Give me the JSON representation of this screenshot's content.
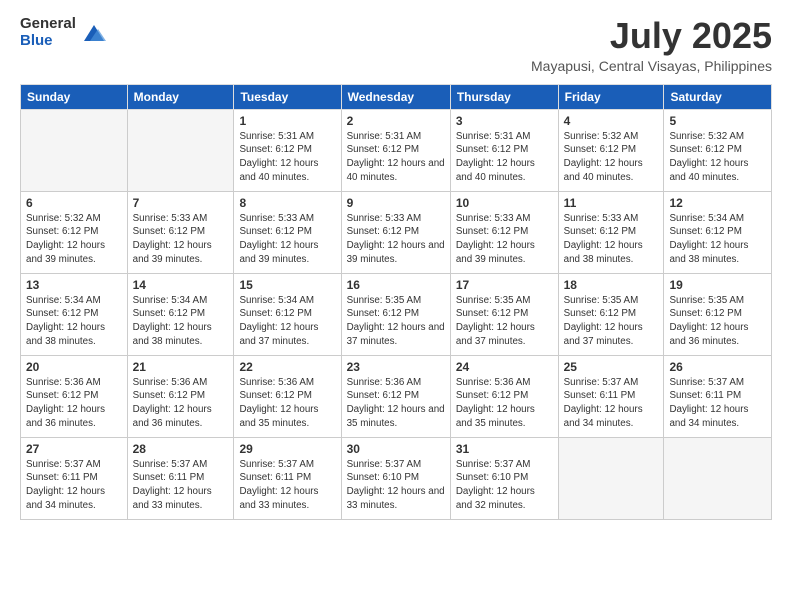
{
  "logo": {
    "general": "General",
    "blue": "Blue"
  },
  "header": {
    "title": "July 2025",
    "subtitle": "Mayapusi, Central Visayas, Philippines"
  },
  "weekdays": [
    "Sunday",
    "Monday",
    "Tuesday",
    "Wednesday",
    "Thursday",
    "Friday",
    "Saturday"
  ],
  "weeks": [
    [
      {
        "day": "",
        "empty": true
      },
      {
        "day": "",
        "empty": true
      },
      {
        "day": "1",
        "sunrise": "Sunrise: 5:31 AM",
        "sunset": "Sunset: 6:12 PM",
        "daylight": "Daylight: 12 hours and 40 minutes."
      },
      {
        "day": "2",
        "sunrise": "Sunrise: 5:31 AM",
        "sunset": "Sunset: 6:12 PM",
        "daylight": "Daylight: 12 hours and 40 minutes."
      },
      {
        "day": "3",
        "sunrise": "Sunrise: 5:31 AM",
        "sunset": "Sunset: 6:12 PM",
        "daylight": "Daylight: 12 hours and 40 minutes."
      },
      {
        "day": "4",
        "sunrise": "Sunrise: 5:32 AM",
        "sunset": "Sunset: 6:12 PM",
        "daylight": "Daylight: 12 hours and 40 minutes."
      },
      {
        "day": "5",
        "sunrise": "Sunrise: 5:32 AM",
        "sunset": "Sunset: 6:12 PM",
        "daylight": "Daylight: 12 hours and 40 minutes."
      }
    ],
    [
      {
        "day": "6",
        "sunrise": "Sunrise: 5:32 AM",
        "sunset": "Sunset: 6:12 PM",
        "daylight": "Daylight: 12 hours and 39 minutes."
      },
      {
        "day": "7",
        "sunrise": "Sunrise: 5:33 AM",
        "sunset": "Sunset: 6:12 PM",
        "daylight": "Daylight: 12 hours and 39 minutes."
      },
      {
        "day": "8",
        "sunrise": "Sunrise: 5:33 AM",
        "sunset": "Sunset: 6:12 PM",
        "daylight": "Daylight: 12 hours and 39 minutes."
      },
      {
        "day": "9",
        "sunrise": "Sunrise: 5:33 AM",
        "sunset": "Sunset: 6:12 PM",
        "daylight": "Daylight: 12 hours and 39 minutes."
      },
      {
        "day": "10",
        "sunrise": "Sunrise: 5:33 AM",
        "sunset": "Sunset: 6:12 PM",
        "daylight": "Daylight: 12 hours and 39 minutes."
      },
      {
        "day": "11",
        "sunrise": "Sunrise: 5:33 AM",
        "sunset": "Sunset: 6:12 PM",
        "daylight": "Daylight: 12 hours and 38 minutes."
      },
      {
        "day": "12",
        "sunrise": "Sunrise: 5:34 AM",
        "sunset": "Sunset: 6:12 PM",
        "daylight": "Daylight: 12 hours and 38 minutes."
      }
    ],
    [
      {
        "day": "13",
        "sunrise": "Sunrise: 5:34 AM",
        "sunset": "Sunset: 6:12 PM",
        "daylight": "Daylight: 12 hours and 38 minutes."
      },
      {
        "day": "14",
        "sunrise": "Sunrise: 5:34 AM",
        "sunset": "Sunset: 6:12 PM",
        "daylight": "Daylight: 12 hours and 38 minutes."
      },
      {
        "day": "15",
        "sunrise": "Sunrise: 5:34 AM",
        "sunset": "Sunset: 6:12 PM",
        "daylight": "Daylight: 12 hours and 37 minutes."
      },
      {
        "day": "16",
        "sunrise": "Sunrise: 5:35 AM",
        "sunset": "Sunset: 6:12 PM",
        "daylight": "Daylight: 12 hours and 37 minutes."
      },
      {
        "day": "17",
        "sunrise": "Sunrise: 5:35 AM",
        "sunset": "Sunset: 6:12 PM",
        "daylight": "Daylight: 12 hours and 37 minutes."
      },
      {
        "day": "18",
        "sunrise": "Sunrise: 5:35 AM",
        "sunset": "Sunset: 6:12 PM",
        "daylight": "Daylight: 12 hours and 37 minutes."
      },
      {
        "day": "19",
        "sunrise": "Sunrise: 5:35 AM",
        "sunset": "Sunset: 6:12 PM",
        "daylight": "Daylight: 12 hours and 36 minutes."
      }
    ],
    [
      {
        "day": "20",
        "sunrise": "Sunrise: 5:36 AM",
        "sunset": "Sunset: 6:12 PM",
        "daylight": "Daylight: 12 hours and 36 minutes."
      },
      {
        "day": "21",
        "sunrise": "Sunrise: 5:36 AM",
        "sunset": "Sunset: 6:12 PM",
        "daylight": "Daylight: 12 hours and 36 minutes."
      },
      {
        "day": "22",
        "sunrise": "Sunrise: 5:36 AM",
        "sunset": "Sunset: 6:12 PM",
        "daylight": "Daylight: 12 hours and 35 minutes."
      },
      {
        "day": "23",
        "sunrise": "Sunrise: 5:36 AM",
        "sunset": "Sunset: 6:12 PM",
        "daylight": "Daylight: 12 hours and 35 minutes."
      },
      {
        "day": "24",
        "sunrise": "Sunrise: 5:36 AM",
        "sunset": "Sunset: 6:12 PM",
        "daylight": "Daylight: 12 hours and 35 minutes."
      },
      {
        "day": "25",
        "sunrise": "Sunrise: 5:37 AM",
        "sunset": "Sunset: 6:11 PM",
        "daylight": "Daylight: 12 hours and 34 minutes."
      },
      {
        "day": "26",
        "sunrise": "Sunrise: 5:37 AM",
        "sunset": "Sunset: 6:11 PM",
        "daylight": "Daylight: 12 hours and 34 minutes."
      }
    ],
    [
      {
        "day": "27",
        "sunrise": "Sunrise: 5:37 AM",
        "sunset": "Sunset: 6:11 PM",
        "daylight": "Daylight: 12 hours and 34 minutes."
      },
      {
        "day": "28",
        "sunrise": "Sunrise: 5:37 AM",
        "sunset": "Sunset: 6:11 PM",
        "daylight": "Daylight: 12 hours and 33 minutes."
      },
      {
        "day": "29",
        "sunrise": "Sunrise: 5:37 AM",
        "sunset": "Sunset: 6:11 PM",
        "daylight": "Daylight: 12 hours and 33 minutes."
      },
      {
        "day": "30",
        "sunrise": "Sunrise: 5:37 AM",
        "sunset": "Sunset: 6:10 PM",
        "daylight": "Daylight: 12 hours and 33 minutes."
      },
      {
        "day": "31",
        "sunrise": "Sunrise: 5:37 AM",
        "sunset": "Sunset: 6:10 PM",
        "daylight": "Daylight: 12 hours and 32 minutes."
      },
      {
        "day": "",
        "empty": true
      },
      {
        "day": "",
        "empty": true
      }
    ]
  ]
}
